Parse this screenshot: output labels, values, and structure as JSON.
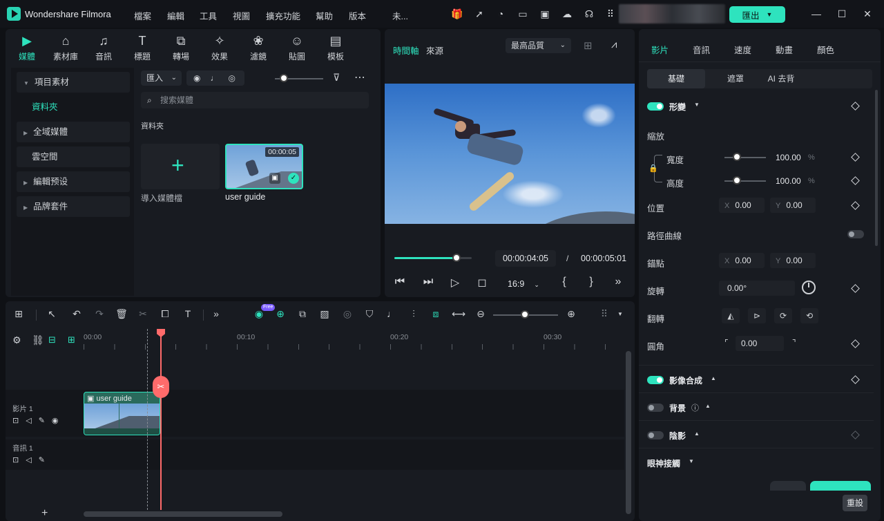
{
  "app": {
    "name": "Wondershare Filmora",
    "project": "未..."
  },
  "menu": [
    "檔案",
    "編輯",
    "工具",
    "視圖",
    "擴充功能",
    "幫助",
    "版本"
  ],
  "export_label": "匯出",
  "media_tabs": [
    {
      "label": "媒體",
      "icon": "media-icon"
    },
    {
      "label": "素材庫",
      "icon": "stock-icon"
    },
    {
      "label": "音訊",
      "icon": "music-icon"
    },
    {
      "label": "標題",
      "icon": "title-icon"
    },
    {
      "label": "轉場",
      "icon": "transition-icon"
    },
    {
      "label": "效果",
      "icon": "effect-icon"
    },
    {
      "label": "濾鏡",
      "icon": "filter-icon"
    },
    {
      "label": "貼圖",
      "icon": "sticker-icon"
    },
    {
      "label": "模板",
      "icon": "template-icon"
    }
  ],
  "sidebar": {
    "items": [
      "項目素材",
      "資料夾",
      "全域媒體",
      "雲空間",
      "編輯预设",
      "品牌套件"
    ]
  },
  "media": {
    "import_label": "匯入",
    "search_placeholder": "搜索媒體",
    "folder_label": "資料夾",
    "import_card": "導入媒體檔",
    "clip_name": "user guide",
    "clip_duration": "00:00:05"
  },
  "preview": {
    "tab_timeline": "時間軸",
    "tab_source": "來源",
    "quality": "最高品質",
    "current_time": "00:00:04:05",
    "separator": "/",
    "total_time": "00:00:05:01",
    "ratio": "16:9",
    "progress": 0.8
  },
  "props": {
    "tabs": [
      "影片",
      "音訊",
      "速度",
      "動畫",
      "顏色"
    ],
    "subtabs": [
      "基礎",
      "遮罩",
      "AI 去背"
    ],
    "transform": "形變",
    "scale": "縮放",
    "width": "寬度",
    "width_value": "100.00",
    "height": "高度",
    "height_value": "100.00",
    "unit": "%",
    "position": "位置",
    "pos_x": "0.00",
    "pos_y": "0.00",
    "x": "X",
    "y": "Y",
    "path_curve": "路徑曲線",
    "anchor": "錨點",
    "anchor_x": "0.00",
    "anchor_y": "0.00",
    "rotate": "旋轉",
    "rotate_value": "0.00°",
    "flip": "翻轉",
    "corner": "圓角",
    "corner_value": "0.00",
    "composite": "影像合成",
    "background": "背景",
    "shadow": "陰影",
    "eye_contact": "眼神接觸",
    "reset": "重設"
  },
  "timeline": {
    "ruler": [
      "00:00",
      "00:10",
      "00:20",
      "00:30"
    ],
    "video_track": "影片 1",
    "audio_track": "音訊 1",
    "clip_label": "user guide",
    "free_badge": "Free"
  }
}
